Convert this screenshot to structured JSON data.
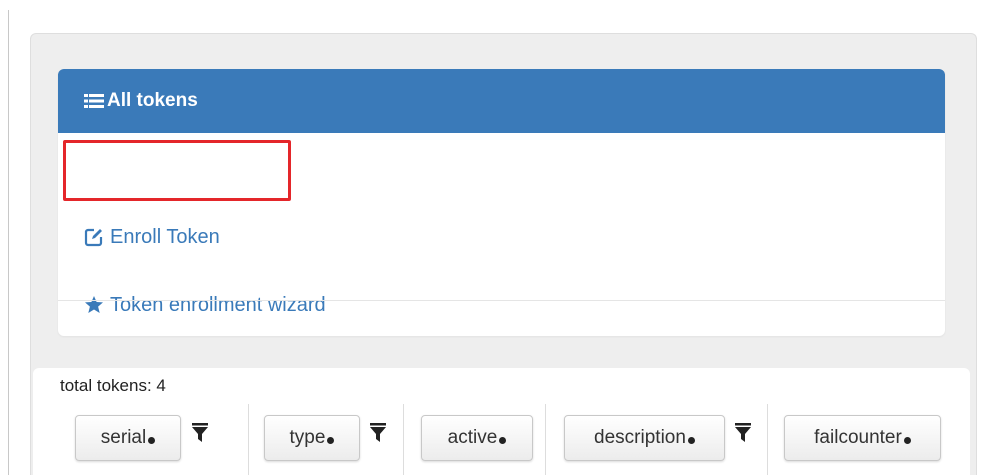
{
  "colors": {
    "accent": "#3a7ab9",
    "header_text": "#ffffff",
    "highlight_border": "#e4262a",
    "panel_background": "#eeeeee"
  },
  "menu": {
    "header": {
      "icon": "list-icon",
      "label": "All tokens"
    },
    "items": [
      {
        "icon": "edit-icon",
        "label": "Enroll Token"
      },
      {
        "icon": "star-icon",
        "label": "Token enrollment wizard"
      }
    ]
  },
  "token_table": {
    "total_label": "total tokens: 4",
    "columns": [
      {
        "label": "serial",
        "sort_icon": "sort-dot-icon",
        "filter_icon": "filter-icon"
      },
      {
        "label": "type",
        "sort_icon": "sort-dot-icon",
        "filter_icon": "filter-icon"
      },
      {
        "label": "active",
        "sort_icon": "sort-dot-icon"
      },
      {
        "label": "description",
        "sort_icon": "sort-dot-icon",
        "filter_icon": "filter-icon"
      },
      {
        "label": "failcounter",
        "sort_icon": "sort-dot-icon"
      }
    ]
  }
}
